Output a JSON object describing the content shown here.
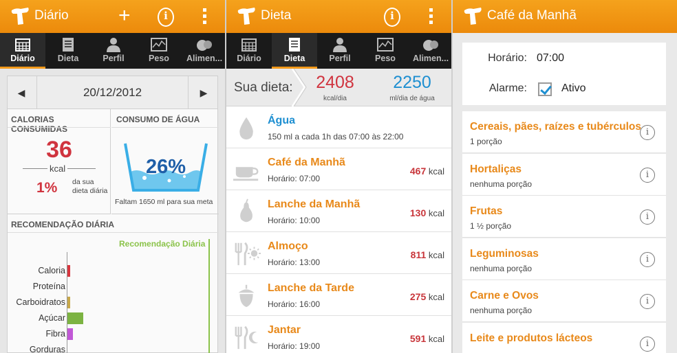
{
  "tabs": [
    {
      "label": "Diário",
      "icon": "calendar-icon"
    },
    {
      "label": "Dieta",
      "icon": "notepad-icon"
    },
    {
      "label": "Perfil",
      "icon": "person-icon"
    },
    {
      "label": "Peso",
      "icon": "chart-icon"
    },
    {
      "label": "Alimen...",
      "icon": "food-icon"
    }
  ],
  "diario": {
    "title": "Diário",
    "date": "20/12/2012",
    "calorias_header": "CALORIAS CONSUMIDAS",
    "agua_header": "CONSUMO DE ÁGUA",
    "calories": "36",
    "kcal": "kcal",
    "pct_dieta": "1%",
    "pct_caption": "da sua dieta diária",
    "agua_pct": "26%",
    "faltam": "Faltam 1650 ml para sua meta",
    "recomendacao_header": "RECOMENDAÇÃO DIÁRIA",
    "recomendacao_label": "Recomendação Diária",
    "nutrients": [
      {
        "label": "Caloria",
        "value": 0.02,
        "color": "#d9363e"
      },
      {
        "label": "Proteína",
        "value": 0.0,
        "color": "#9e9e9e"
      },
      {
        "label": "Carboidratos",
        "value": 0.02,
        "color": "#c8a84a"
      },
      {
        "label": "Açúcar",
        "value": 0.11,
        "color": "#7cb342"
      },
      {
        "label": "Fibra",
        "value": 0.04,
        "color": "#c158d6"
      },
      {
        "label": "Gorduras",
        "value": 0.0,
        "color": "#9e9e9e"
      }
    ]
  },
  "dieta": {
    "title": "Dieta",
    "sua_dieta": "Sua dieta:",
    "kcal_value": "2408",
    "kcal_label": "kcal/dia",
    "agua_value": "2250",
    "agua_label": "ml/dia de água",
    "meals": [
      {
        "name": "Água",
        "sub": "150 ml a cada 1h das 07:00 às 22:00",
        "kcal": "",
        "unit": "",
        "icon": "water-drop-icon",
        "color": "#1e8fd1"
      },
      {
        "name": "Café da Manhã",
        "sub": "Horário: 07:00",
        "kcal": "467",
        "unit": "kcal",
        "icon": "coffee-cup-icon",
        "color": "#e8891a"
      },
      {
        "name": "Lanche da Manhã",
        "sub": "Horário: 10:00",
        "kcal": "130",
        "unit": "kcal",
        "icon": "pear-icon",
        "color": "#e8891a"
      },
      {
        "name": "Almoço",
        "sub": "Horário: 13:00",
        "kcal": "811",
        "unit": "kcal",
        "icon": "cutlery-sun-icon",
        "color": "#e8891a"
      },
      {
        "name": "Lanche da Tarde",
        "sub": "Horário: 16:00",
        "kcal": "275",
        "unit": "kcal",
        "icon": "acorn-icon",
        "color": "#e8891a"
      },
      {
        "name": "Jantar",
        "sub": "Horário: 19:00",
        "kcal": "591",
        "unit": "kcal",
        "icon": "cutlery-moon-icon",
        "color": "#e8891a"
      }
    ]
  },
  "cafe": {
    "title": "Café da Manhã",
    "horario_label": "Horário:",
    "horario_value": "07:00",
    "alarme_label": "Alarme:",
    "alarme_value": "Ativo",
    "groups": [
      {
        "name": "Cereais, pães, raízes e tubérculos",
        "sub": "1  porção"
      },
      {
        "name": "Hortaliças",
        "sub": "nenhuma porção"
      },
      {
        "name": "Frutas",
        "sub": "1 ½ porção"
      },
      {
        "name": "Leguminosas",
        "sub": "nenhuma porção"
      },
      {
        "name": "Carne e Ovos",
        "sub": "nenhuma porção"
      },
      {
        "name": "Leite e produtos lácteos",
        "sub": ""
      }
    ]
  },
  "colors": {
    "accent": "#f39a1a",
    "calorie_red": "#d0343f",
    "water_blue": "#1f5fa8",
    "meal_orange": "#e8891a"
  }
}
